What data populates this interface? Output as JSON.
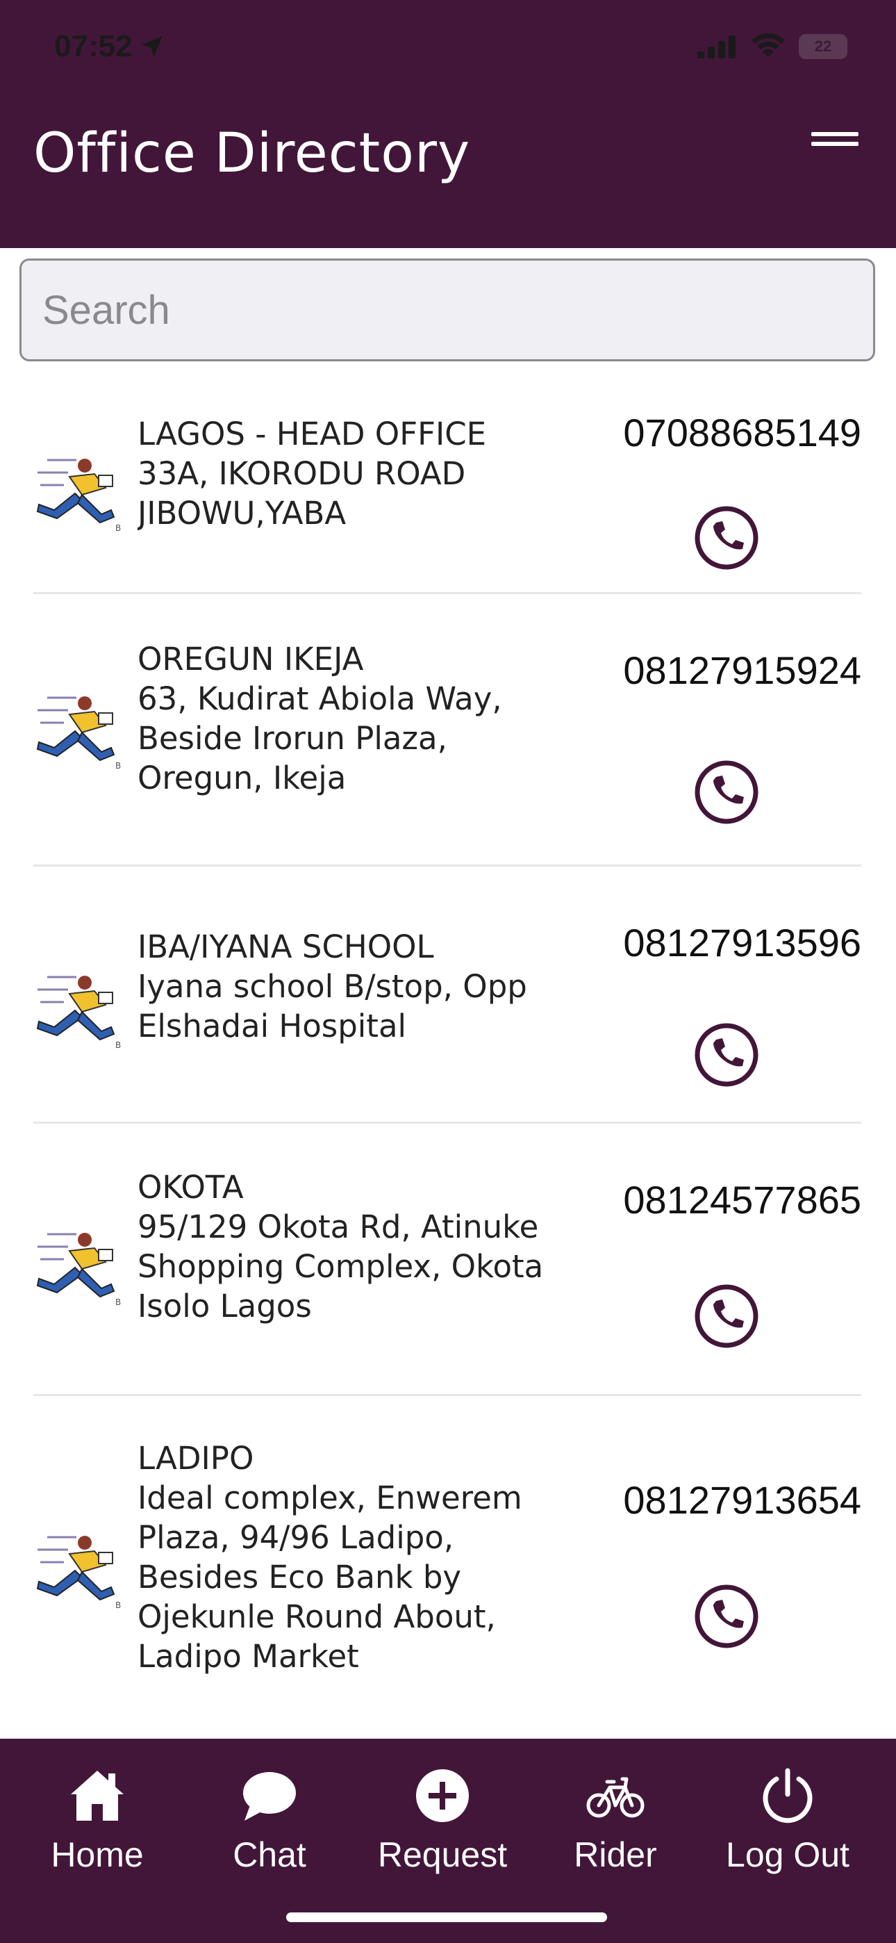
{
  "status_bar": {
    "time": "07:52",
    "battery": "22"
  },
  "header": {
    "title": "Office Directory"
  },
  "search": {
    "placeholder": "Search"
  },
  "offices": [
    {
      "address": "LAGOS - HEAD OFFICE\n33A, IKORODU ROAD\nJIBOWU,YABA",
      "phone": "07088685149"
    },
    {
      "address": "OREGUN IKEJA\n63, Kudirat Abiola Way,\nBeside Irorun Plaza,\nOregun, Ikeja",
      "phone": "08127915924"
    },
    {
      "address": "IBA/IYANA SCHOOL\nIyana school B/stop, Opp\nElshadai Hospital",
      "phone": "08127913596"
    },
    {
      "address": "OKOTA\n95/129 Okota Rd, Atinuke\nShopping Complex, Okota\nIsolo Lagos",
      "phone": "08124577865"
    },
    {
      "address": "LADIPO\nIdeal complex, Enwerem\nPlaza, 94/96 Ladipo,\nBesides Eco Bank by\nOjekunle Round About,\nLadipo Market",
      "phone": "08127913654"
    }
  ],
  "nav": {
    "home": "Home",
    "chat": "Chat",
    "request": "Request",
    "rider": "Rider",
    "logout": "Log Out"
  },
  "colors": {
    "brand": "#421639",
    "icon": "#421639"
  }
}
